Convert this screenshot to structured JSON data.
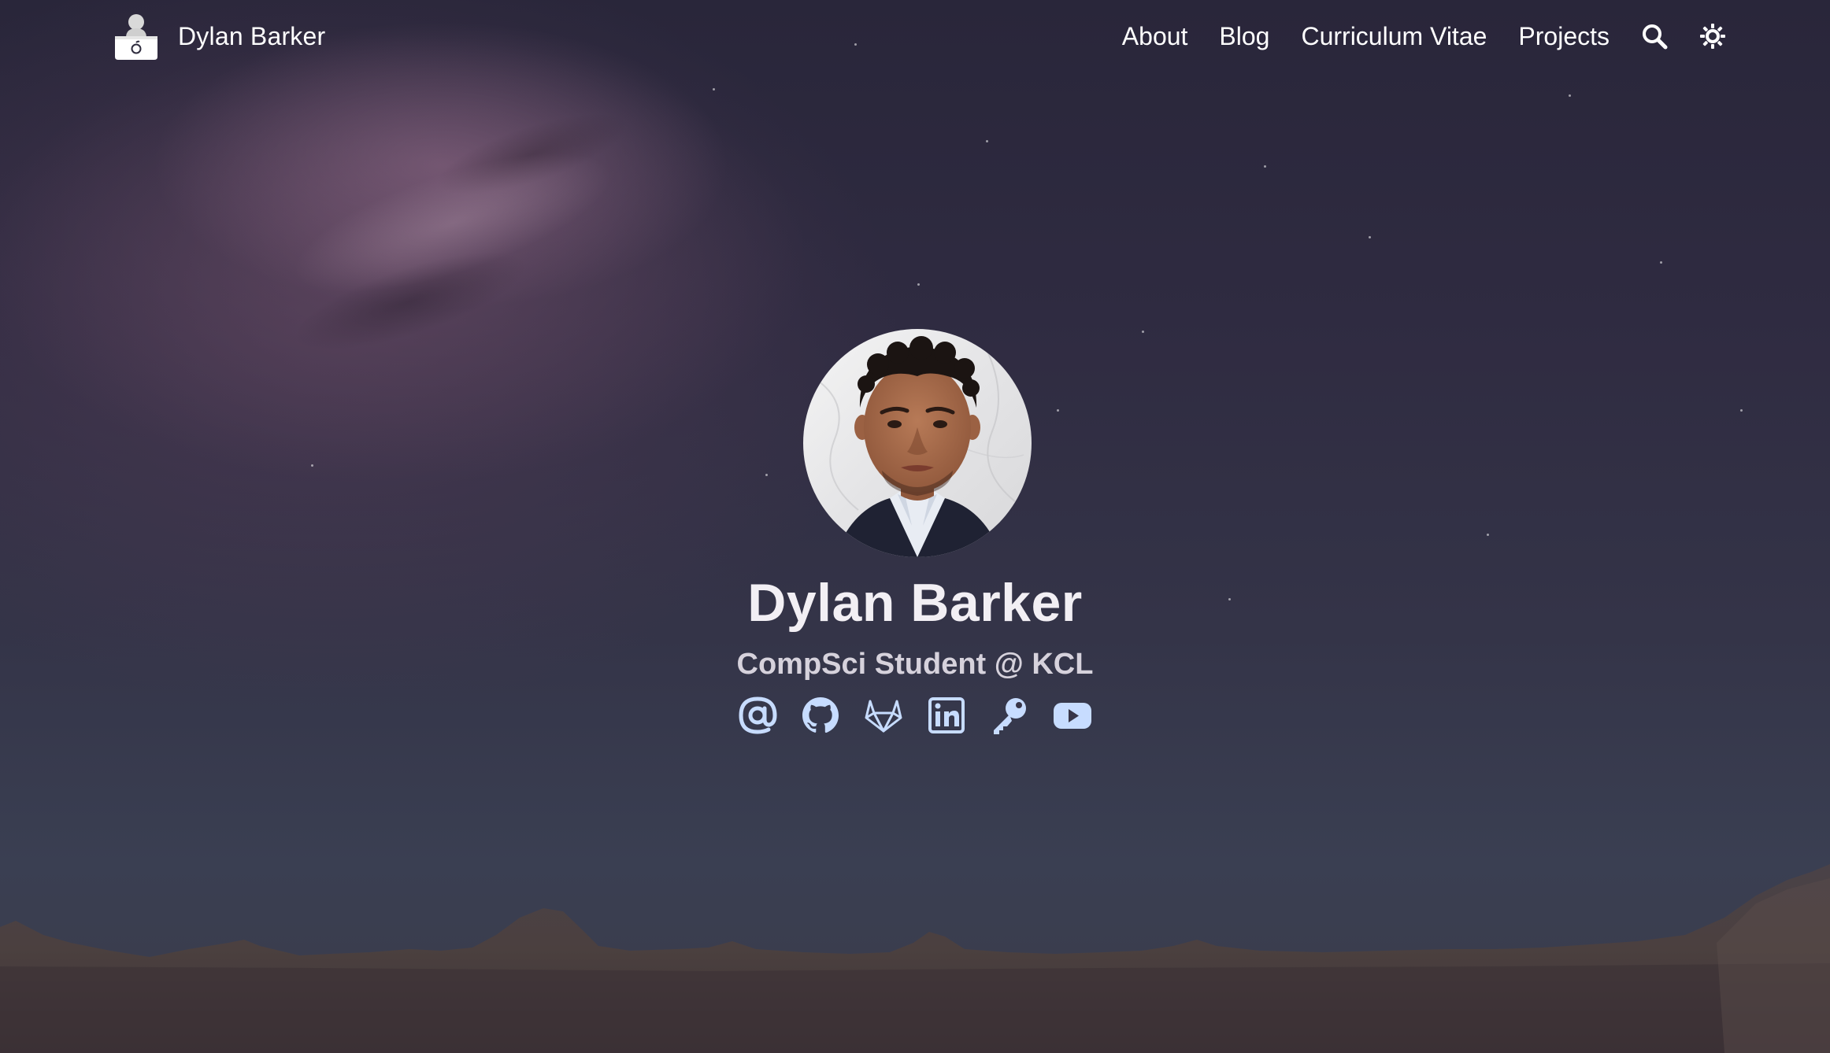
{
  "site": {
    "brand_name": "Dylan Barker"
  },
  "nav": {
    "items": [
      {
        "label": "About"
      },
      {
        "label": "Blog"
      },
      {
        "label": "Curriculum Vitae"
      },
      {
        "label": "Projects"
      }
    ],
    "search_icon": "search-icon",
    "theme_icon": "theme-toggle-icon"
  },
  "hero": {
    "name": "Dylan Barker",
    "subtitle": "CompSci Student @ KCL",
    "avatar_alt": "Dylan Barker",
    "socials": [
      {
        "icon": "email-icon"
      },
      {
        "icon": "github-icon"
      },
      {
        "icon": "gitlab-icon"
      },
      {
        "icon": "linkedin-icon"
      },
      {
        "icon": "key-icon"
      },
      {
        "icon": "youtube-icon"
      }
    ]
  },
  "colors": {
    "accent": "#c7dcff",
    "text": "#ffffff",
    "subtitle": "#d6d2dc"
  }
}
